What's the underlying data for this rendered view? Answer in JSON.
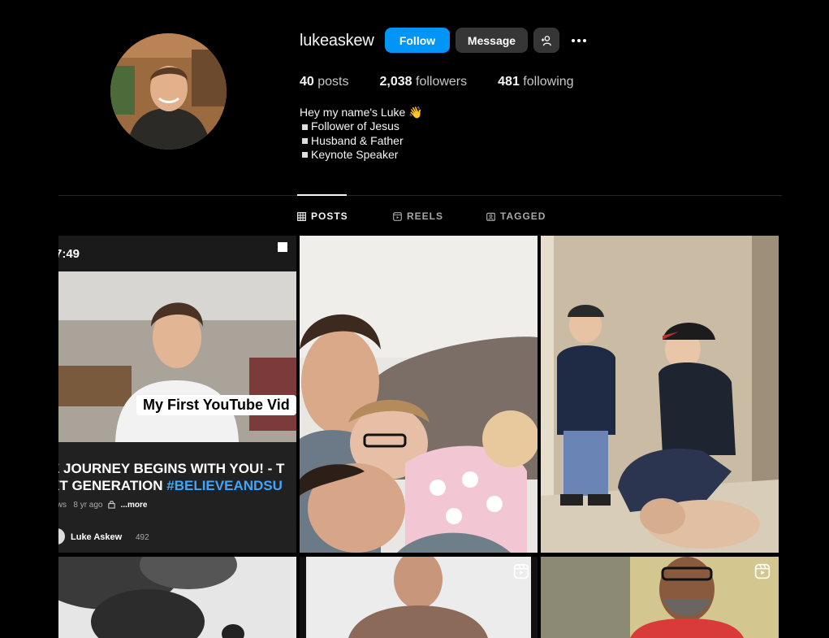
{
  "profile": {
    "username": "lukeaskew",
    "follow_label": "Follow",
    "message_label": "Message",
    "more_label": "•••",
    "stats": {
      "posts_count": "40",
      "posts_label": "posts",
      "followers_count": "2,038",
      "followers_label": "followers",
      "following_count": "481",
      "following_label": "following"
    },
    "bio": [
      "Hey my name's Luke 👋",
      "Follower of Jesus",
      "Husband & Father",
      "Keynote Speaker"
    ]
  },
  "tabs": [
    {
      "label": "POSTS",
      "icon": "grid-icon",
      "active": true
    },
    {
      "label": "REELS",
      "icon": "reels-icon",
      "active": false
    },
    {
      "label": "TAGGED",
      "icon": "tagged-icon",
      "active": false
    }
  ],
  "posts": {
    "youtube_post": {
      "phone_time": "7:49",
      "caption": "My First YouTube Vid",
      "title_line1": "E JOURNEY BEGINS WITH YOU! - T",
      "title_line2_prefix": "XT GENERATION ",
      "title_line2_hashtag": "#BELIEVEANDSU",
      "meta_views": "iews",
      "meta_age": "8 yr ago",
      "meta_more": "...more",
      "channel_name": "Luke Askew",
      "channel_subs": "492"
    }
  },
  "colors": {
    "background": "#000000",
    "follow_button": "#0095f6",
    "secondary_button": "#363636",
    "text_primary": "#f5f5f5",
    "text_secondary": "#a8a8a8",
    "hashtag": "#3ea6ff"
  }
}
